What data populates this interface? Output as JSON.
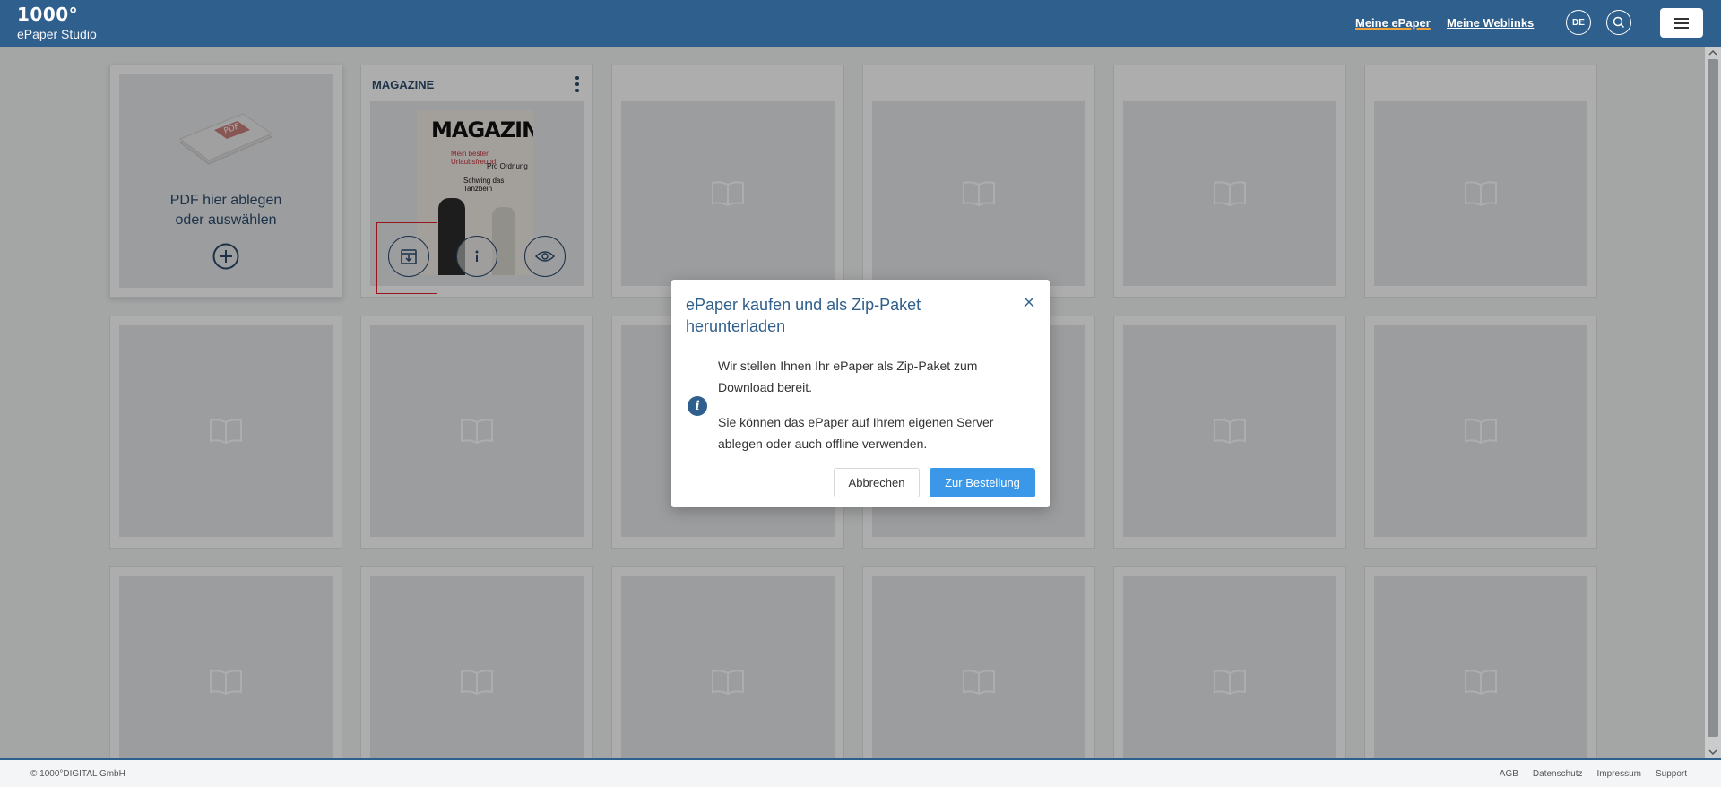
{
  "header": {
    "logo_mark": "1000°",
    "logo_sub": "ePaper Studio",
    "nav": [
      "Meine ePaper",
      "Meine Weblinks"
    ],
    "language": "DE"
  },
  "upload": {
    "line1": "PDF hier ablegen",
    "line2": "oder auswählen",
    "pdf_badge": "PDF"
  },
  "magazine": {
    "card_title": "MAGAZINE",
    "cover_title": "MAGAZINE",
    "cover_lines": [
      "Mein bester Urlaubsfreund",
      "Pro Ordnung",
      "Schwing das Tanzbein"
    ]
  },
  "modal": {
    "title": "ePaper kaufen und als Zip-Paket herunterladen",
    "paragraph1": "Wir stellen Ihnen Ihr ePaper als Zip-Paket zum Download bereit.",
    "paragraph2": "Sie können das ePaper auf Ihrem eigenen Server ablegen oder auch offline verwenden.",
    "cancel_label": "Abbrechen",
    "order_label": "Zur Bestellung"
  },
  "footer": {
    "copyright": "© 1000°DIGITAL GmbH",
    "links": [
      "AGB",
      "Datenschutz",
      "Impressum",
      "Support"
    ]
  },
  "colors": {
    "header": "#2f5f8c",
    "primary_button": "#3b97e8",
    "highlight": "#e0202a"
  },
  "icons": [
    "plus-circle-icon",
    "kebab-menu-icon",
    "download-archive-icon",
    "info-icon",
    "eye-icon",
    "book-icon",
    "search-icon",
    "hamburger-icon",
    "close-icon"
  ]
}
